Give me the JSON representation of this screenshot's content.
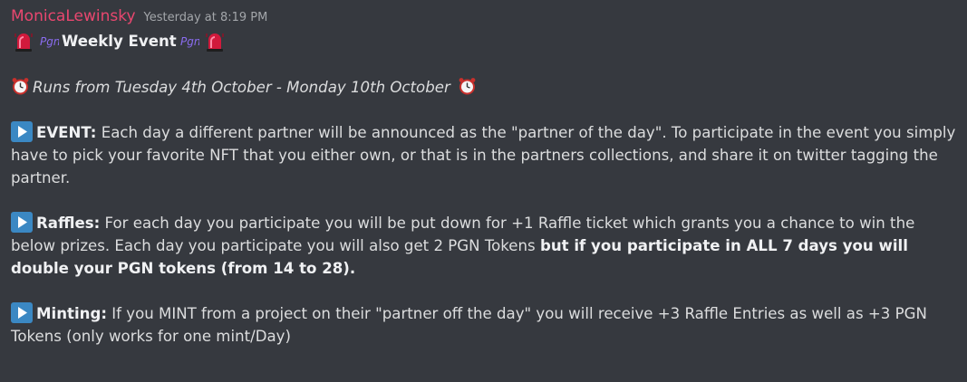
{
  "message": {
    "author": "MonicaLewinsky",
    "timestamp": "Yesterday at 8:19 PM",
    "author_color": "#e9476f",
    "title": "Weekly Event",
    "title_emojis": [
      "siren-icon",
      "pgn-logo-icon",
      "pgn-logo-icon",
      "siren-icon"
    ],
    "runs": "Runs from Tuesday 4th October - Monday 10th October",
    "runs_emojis": [
      "alarm-clock-icon",
      "alarm-clock-icon"
    ],
    "event": {
      "label": "EVENT:",
      "text": " Each day a different partner will be announced as the \"partner of the day\". To participate in the event you simply have to pick your favorite NFT that you either own, or that is in the partners collections, and share it on twitter tagging the partner."
    },
    "raffles": {
      "label": "Raffles:",
      "text": " For each day you participate you will be put down for +1 Raffle ticket which grants you a chance to win the below prizes. Each day you participate you will also get 2 PGN Tokens ",
      "bold_text": "but if you participate in ALL 7 days you will double your PGN tokens (from 14 to 28)."
    },
    "minting": {
      "label": "Minting:",
      "text": " If you MINT from a project on their \"partner off the day\" you will receive +3 Raffle Entries as well as +3 PGN Tokens (only works for one mint/Day)"
    },
    "bullet_icon": "play-button-icon"
  }
}
